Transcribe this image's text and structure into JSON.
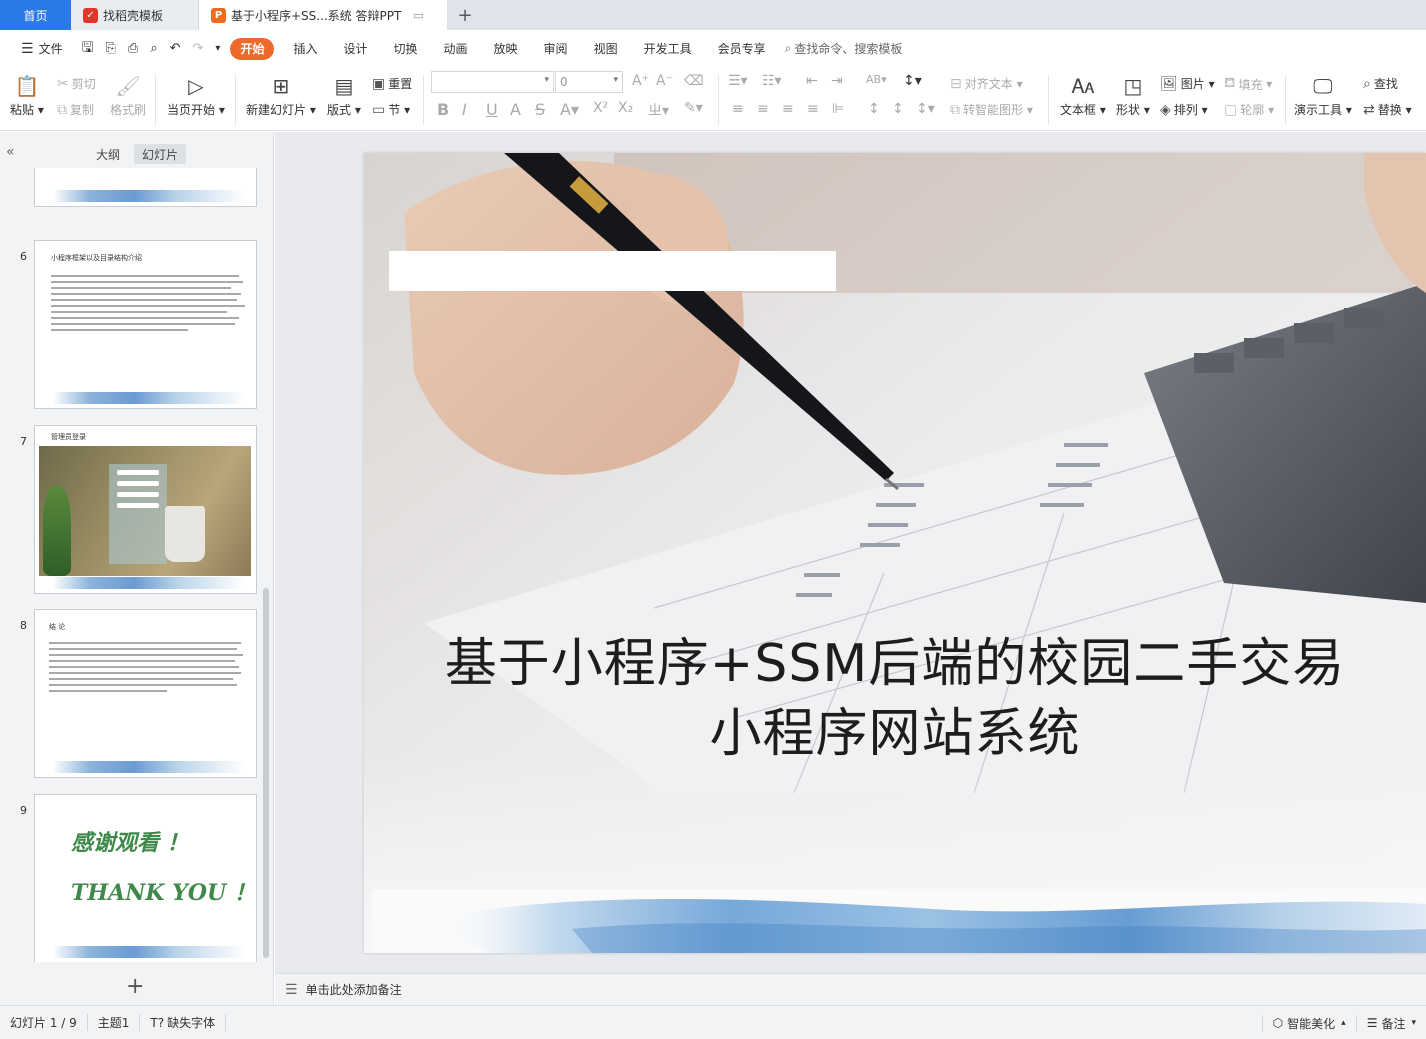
{
  "tabs": [
    {
      "label": "首页"
    },
    {
      "label": "找稻壳模板",
      "icon": "docer-icon"
    },
    {
      "label": "基于小程序+SS...系统 答辩PPT",
      "icon": "ppt-icon"
    }
  ],
  "menu": {
    "file": "文件",
    "items": [
      "开始",
      "插入",
      "设计",
      "切换",
      "动画",
      "放映",
      "审阅",
      "视图",
      "开发工具",
      "会员专享"
    ],
    "search": "查找命令、搜索模板"
  },
  "toolbar": {
    "paste": "粘贴",
    "cut": "剪切",
    "copy": "复制",
    "format_painter": "格式刷",
    "play_from_current": "当页开始",
    "new_slide": "新建幻灯片",
    "layout": "版式",
    "reset": "重置",
    "section": "节",
    "font_size": "0",
    "align_text": "对齐文本",
    "smart_convert": "转智能图形",
    "textbox": "文本框",
    "shape": "形状",
    "picture": "图片",
    "arrange": "排列",
    "fill": "填充",
    "outline": "轮廓",
    "presenter_tools": "演示工具",
    "find": "查找",
    "replace": "替换"
  },
  "left_panel": {
    "tab_outline": "大纲",
    "tab_slides": "幻灯片",
    "slides": [
      {
        "num": "6",
        "title": "小程序框架以及目录结构介绍"
      },
      {
        "num": "7",
        "title": "管理员登录"
      },
      {
        "num": "8",
        "title": "结  论"
      },
      {
        "num": "9",
        "line1": "感谢观看 ！",
        "line2": "THANK    YOU ！"
      }
    ]
  },
  "slide": {
    "title_line1": "基于小程序+SSM后端的校园二手交易",
    "title_line2": "小程序网站系统"
  },
  "notes_placeholder": "单击此处添加备注",
  "status": {
    "slide_counter": "幻灯片 1 / 9",
    "theme": "主题1",
    "missing_font": "缺失字体",
    "smart_beautify": "智能美化",
    "notes": "备注"
  }
}
